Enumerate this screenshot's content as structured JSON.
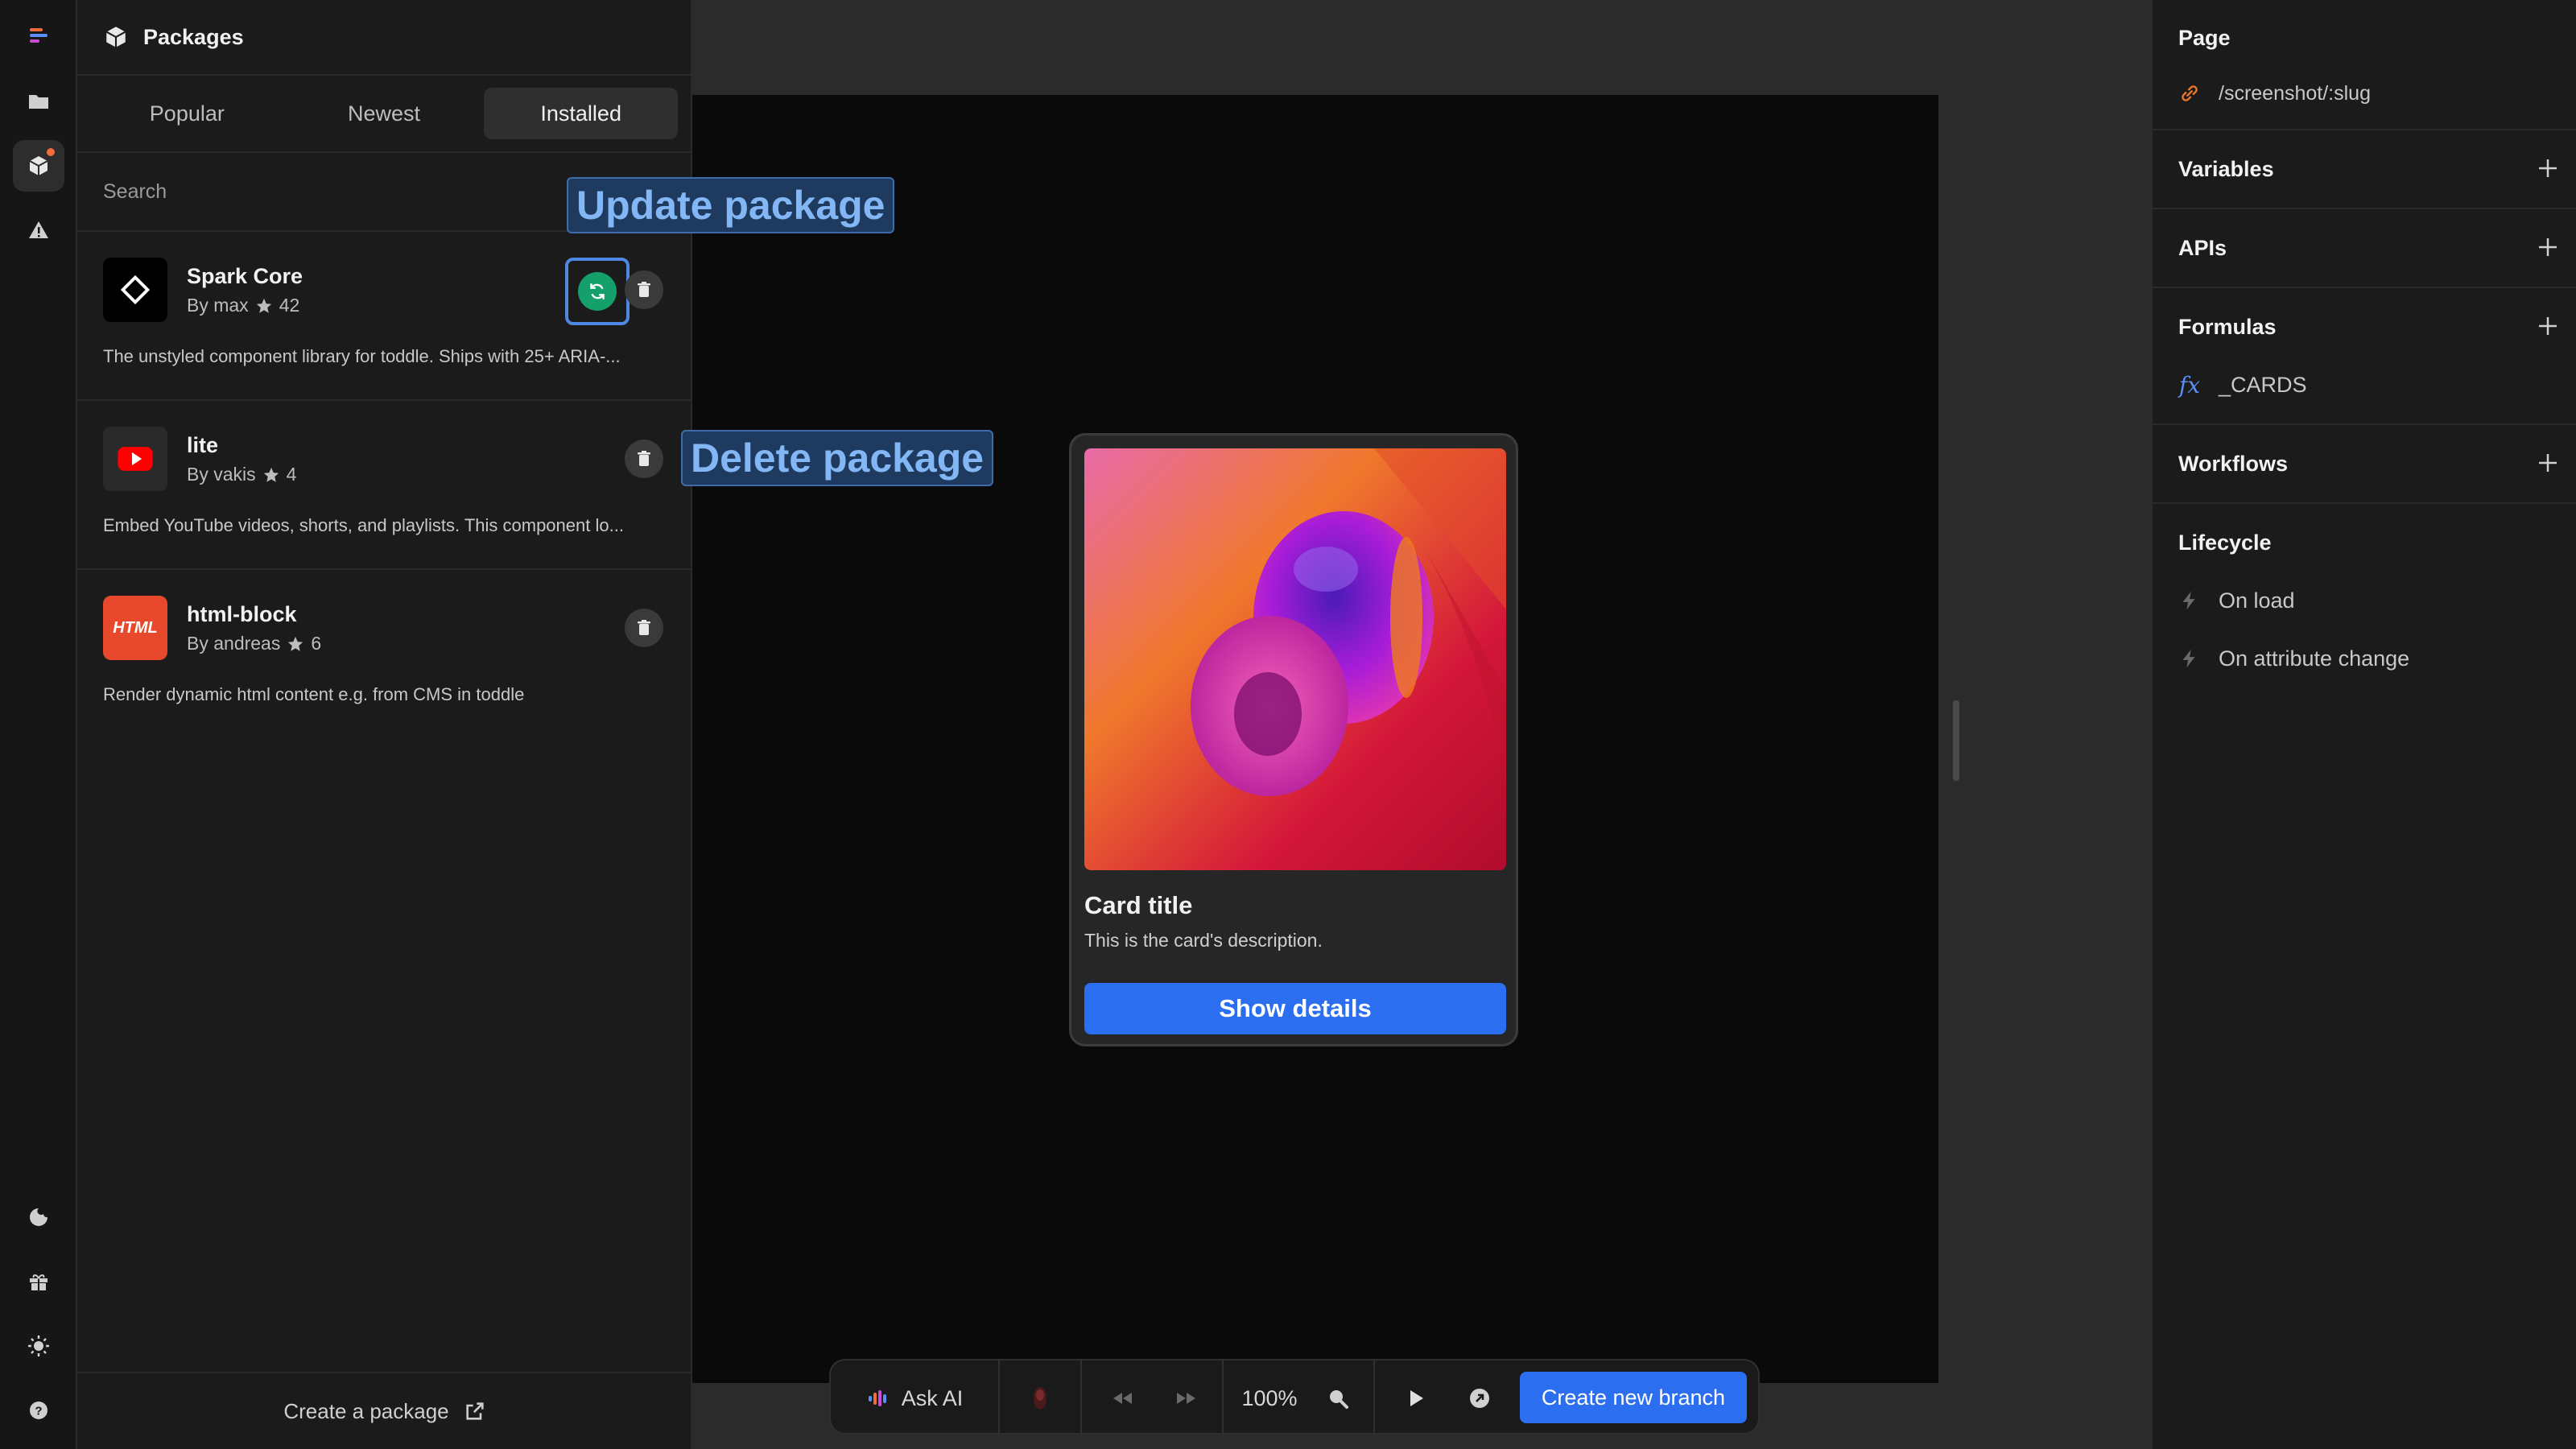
{
  "packages_panel": {
    "title": "Packages",
    "tabs": [
      {
        "label": "Popular"
      },
      {
        "label": "Newest"
      },
      {
        "label": "Installed"
      }
    ],
    "search_placeholder": "Search",
    "items": [
      {
        "name": "Spark Core",
        "author": "By max",
        "stars": "42",
        "description": "The unstyled component library for toddle. Ships with 25+ ARIA-..."
      },
      {
        "name": "lite",
        "author": "By vakis",
        "stars": "4",
        "description": "Embed YouTube videos, shorts, and playlists. This component lo..."
      },
      {
        "name": "html-block",
        "author": "By andreas",
        "stars": "6",
        "description": "Render dynamic html content e.g. from CMS in toddle"
      }
    ],
    "html_logo_text": "HTML",
    "footer_label": "Create a package"
  },
  "callouts": {
    "update": "Update package",
    "delete": "Delete package"
  },
  "card": {
    "title": "Card title",
    "description": "This is the card's description.",
    "button_label": "Show details"
  },
  "toolbar": {
    "ask_ai": "Ask AI",
    "zoom": "100%",
    "create_branch": "Create new branch"
  },
  "right_panel": {
    "page_label": "Page",
    "page_route": "/screenshot/:slug",
    "variables": "Variables",
    "apis": "APIs",
    "formulas": "Formulas",
    "formula_items": [
      "_CARDS"
    ],
    "workflows": "Workflows",
    "lifecycle": "Lifecycle",
    "lifecycle_items": [
      "On load",
      "On attribute change"
    ]
  },
  "colors": {
    "accent_blue": "#2b6ff0",
    "update_green": "#15a06b",
    "notification_orange": "#f26b3a",
    "callout_text": "#82b6f5"
  }
}
